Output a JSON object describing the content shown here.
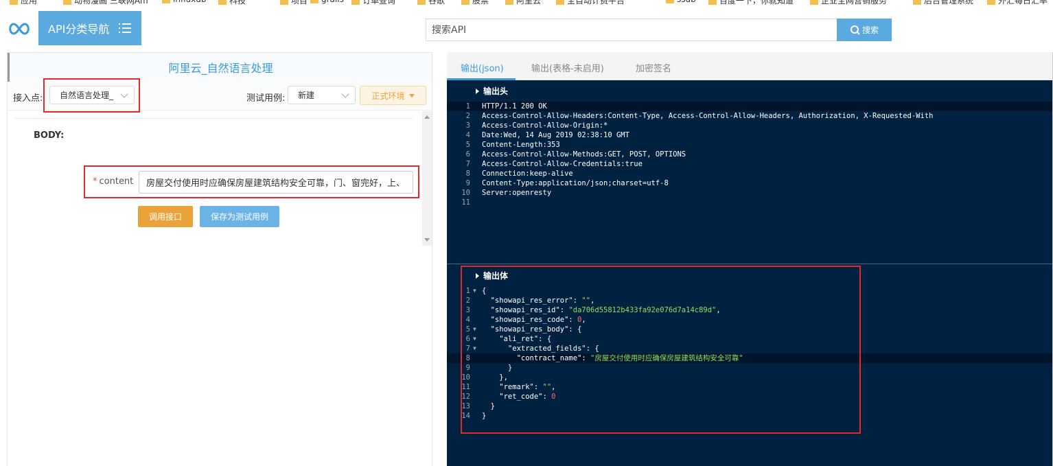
{
  "bookmarks": [
    "应用",
    "动物漫画 三联网Am",
    "influxdb",
    "科技",
    "项目",
    "grails",
    "订单查询",
    "谷歌",
    "股票",
    "阿里云",
    "全自动计费平台",
    "ssdb",
    "百度一下，你就知道",
    "企业全网营销服务",
    "后台管理系统",
    "外汇每日汇率"
  ],
  "header": {
    "nav_label": "API分类导航",
    "search_placeholder": "搜索API",
    "search_button": "搜索"
  },
  "left": {
    "title": "阿里云_自然语言处理",
    "endpoint_label": "接入点:",
    "endpoint_value": "自然语言处理_",
    "testcase_label": "测试用例:",
    "testcase_value": "新建",
    "env_label": "正式环境",
    "body_label": "BODY:",
    "field_required_mark": "*",
    "field_label": "content",
    "field_value": "房屋交付使用时应确保房屋建筑结构安全可靠，门、窗完好，上、",
    "call_button": "调用接口",
    "save_button": "保存为测试用例"
  },
  "right": {
    "tabs": [
      "输出(json)",
      "输出(表格-未启用)",
      "加密签名"
    ],
    "active_tab": 0,
    "header_section": "输出头",
    "header_lines": [
      "HTTP/1.1 200 OK",
      "Access-Control-Allow-Headers:Content-Type, Access-Control-Allow-Headers, Authorization, X-Requested-With",
      "Access-Control-Allow-Origin:*",
      "Date:Wed, 14 Aug 2019 02:38:10 GMT",
      "Content-Length:353",
      "Access-Control-Allow-Methods:GET, POST, OPTIONS",
      "Access-Control-Allow-Credentials:true",
      "Connection:keep-alive",
      "Content-Type:application/json;charset=utf-8",
      "Server:openresty",
      ""
    ],
    "body_section": "输出体",
    "body_lines": [
      "{",
      "  \"showapi_res_error\": \"\",",
      "  \"showapi_res_id\": \"da706d55812b433fa92e076d7a14c89d\",",
      "  \"showapi_res_code\": 0,",
      "  \"showapi_res_body\": {",
      "    \"ali_ret\": {",
      "      \"extracted_fields\": {",
      "        \"contract_name\": \"房屋交付使用时应确保房屋建筑结构安全可靠\"",
      "      }",
      "    },",
      "    \"remark\": \"\",",
      "    \"ret_code\": 0",
      "  }",
      "}"
    ],
    "fold_lines": [
      1,
      5,
      6,
      7
    ]
  },
  "colors": {
    "accent": "#5aa9df",
    "editor_bg": "#002240",
    "string": "#8ee05c",
    "number": "#ff6b6b",
    "highlight": "#e02b2b",
    "env": "#e9a33a"
  }
}
